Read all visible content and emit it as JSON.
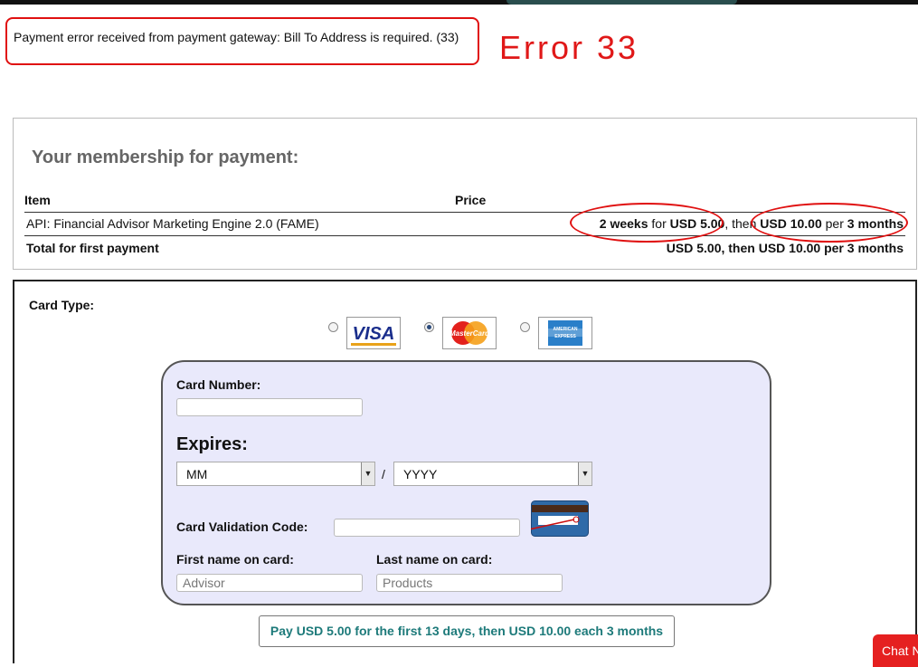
{
  "error": {
    "message": "Payment error received from payment gateway: Bill To Address is required. (33)",
    "annotation": "Error 33"
  },
  "membership": {
    "heading": "Your membership for payment:",
    "col_item": "Item",
    "col_price": "Price",
    "row": {
      "name": "API: Financial Advisor Marketing Engine 2.0 (FAME)",
      "trial_period": "2 weeks",
      "for_word": "for",
      "trial_price": "USD 5.00",
      "then_word": ", then",
      "regular_price": "USD 10.00",
      "per_word": "per",
      "regular_period": "3 months"
    },
    "total_label": "Total for first payment",
    "total_value": "USD 5.00, then USD 10.00 per 3 months"
  },
  "payment": {
    "card_type_label": "Card Type:",
    "card_options": [
      {
        "name": "VISA",
        "selected": false
      },
      {
        "name": "MasterCard",
        "selected": true
      },
      {
        "name": "AMERICAN EXPRESS",
        "selected": false
      }
    ],
    "card_number_label": "Card Number:",
    "expires_label": "Expires:",
    "month_value": "MM",
    "year_value": "YYYY",
    "slash": "/",
    "cvc_label": "Card Validation Code:",
    "first_name_label": "First name on card:",
    "first_name_value": "Advisor",
    "last_name_label": "Last name on card:",
    "last_name_value": "Products",
    "pay_button": "Pay USD 5.00 for the first 13 days, then USD 10.00 each 3 months"
  },
  "chat_button": "Chat N",
  "colors": {
    "annotation_red": "#e01010",
    "panel_bg": "#e9e9fb",
    "button_text": "#1d7a7a",
    "chat_bg": "#e52020"
  }
}
